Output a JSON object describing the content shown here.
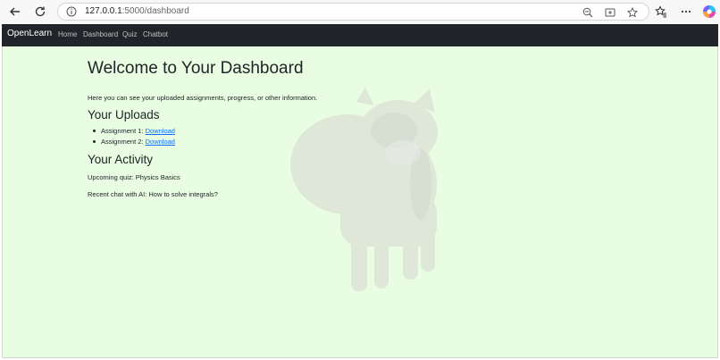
{
  "browser": {
    "url_host": "127.0.0.1",
    "url_path": ":5000/dashboard",
    "icons": [
      "back-icon",
      "reload-icon",
      "site-info-icon",
      "zoom-out-icon",
      "install-app-icon",
      "favorite-star-icon",
      "favorites-icon",
      "more-icon",
      "copilot-icon"
    ]
  },
  "navbar": {
    "brand": "OpenLearn",
    "links": [
      "Home",
      "Dashboard",
      "Quiz",
      "Chatbot"
    ],
    "background": "#212529"
  },
  "page": {
    "background": "#e8fde1",
    "title": "Welcome to Your Dashboard",
    "intro": "Here you can see your uploaded assignments, progress, or other information.",
    "uploads": {
      "heading": "Your Uploads",
      "items": [
        {
          "label": "Assignment 1: ",
          "link": "Download"
        },
        {
          "label": "Assignment 2: ",
          "link": "Download"
        }
      ]
    },
    "activity": {
      "heading": "Your Activity",
      "upcoming": "Upcoming quiz: Physics Basics",
      "recent_chat": "Recent chat with AI: How to solve integrals?"
    },
    "link_color": "#0d6efd"
  }
}
